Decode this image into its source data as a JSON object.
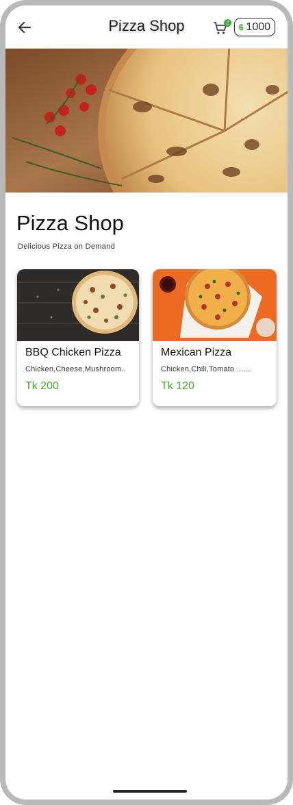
{
  "appbar": {
    "title": "Pizza Shop",
    "cart_count": "2",
    "coin_symbol": "$",
    "coin_balance": "1000"
  },
  "shop": {
    "title": "Pizza Shop",
    "subtitle": "Delicious Pizza on Demand"
  },
  "products": [
    {
      "name": "BBQ Chicken Pizza",
      "ingredients": "Chicken,Cheese,Mushroom..",
      "price": "Tk 200"
    },
    {
      "name": "Mexican Pizza",
      "ingredients": "Chicken,Chili,Tomato .......",
      "price": "Tk 120"
    }
  ],
  "colors": {
    "accent_green": "#4ca52e",
    "badge_green": "#3aa935",
    "frame_gray": "#b9b9b9"
  },
  "icons": {
    "back": "arrow-left-icon",
    "cart": "shopping-cart-icon",
    "coin": "dollar-coin-icon"
  }
}
